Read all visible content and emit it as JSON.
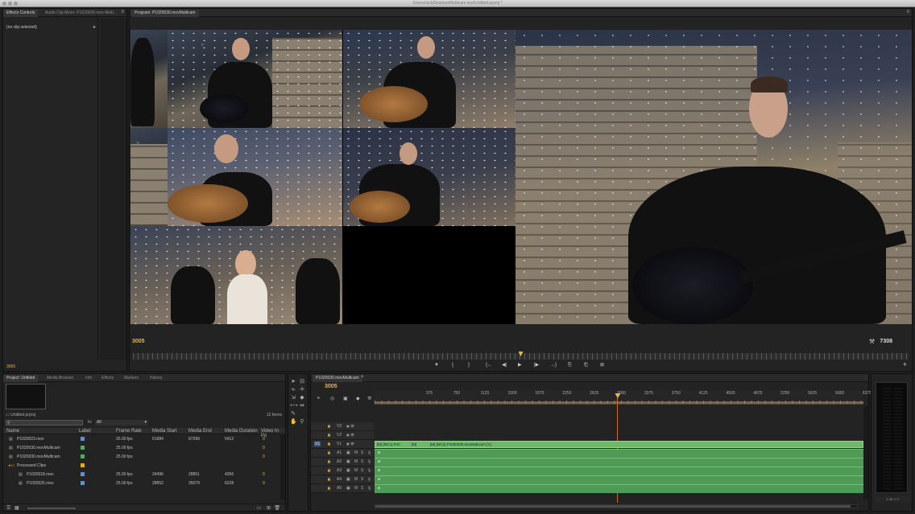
{
  "window": {
    "title": "/Users/nick/Desktop/Multicam test/Untitled.prproj *"
  },
  "effects_panel": {
    "tabs": [
      "Effects Controls",
      "Audio Clip Mixer: P1020030.mov Multi..."
    ],
    "no_clip": "(no clip selected)",
    "timecode": "3005"
  },
  "program": {
    "tab": "Program: P1020030.movMulticam",
    "timecode_current": "3005",
    "timecode_duration": "7308",
    "playhead_fraction": 0.5
  },
  "transport": {
    "buttons": [
      "▼",
      "{",
      "}",
      "{←",
      "◀|",
      "▶",
      "|▶",
      "→}",
      "⎘",
      "⎗",
      "⊞"
    ],
    "add": "+"
  },
  "project_panel": {
    "tabs": [
      "Project: Untitled",
      "Media Browser",
      "Info",
      "Effects",
      "Markers",
      "History"
    ],
    "file": "Untitled.prproj",
    "items_count": "12 Items",
    "in_label": "In:",
    "in_value": "All",
    "columns": [
      "Name",
      "Label",
      "Frame Rate",
      "Media Start",
      "Media End",
      "Media Duration",
      "Video In Po"
    ],
    "rows": [
      {
        "name": "P1020023.mov",
        "color": "#5b8fd6",
        "rate": "25.00 fps",
        "start": "61984",
        "end": "67399",
        "duration": "5412",
        "vin": "0",
        "indent": 0
      },
      {
        "name": "P1020030.movMulticam",
        "color": "#4fae5a",
        "rate": "25.00 fps",
        "start": "",
        "end": "",
        "duration": "",
        "vin": "0",
        "indent": 0
      },
      {
        "name": "P1020030.movMulticam",
        "color": "#4fae5a",
        "rate": "25.00 fps",
        "start": "",
        "end": "",
        "duration": "",
        "vin": "0",
        "indent": 0
      },
      {
        "name": "Processed Clips",
        "color": "#e0a73c",
        "rate": "",
        "start": "",
        "end": "",
        "duration": "",
        "vin": "",
        "indent": 0
      },
      {
        "name": "P1020018.mov",
        "color": "#5b8fd6",
        "rate": "25.00 fps",
        "start": "24496",
        "end": "28851",
        "duration": "4356",
        "vin": "0",
        "indent": 1
      },
      {
        "name": "P1020025.mov",
        "color": "#5b8fd6",
        "rate": "25.00 fps",
        "start": "28852",
        "end": "35079",
        "duration": "6228",
        "vin": "0",
        "indent": 1
      }
    ]
  },
  "timeline": {
    "tab": "P1020030.movMulticam",
    "timecode": "3005",
    "ruler": [
      "375",
      "750",
      "1125",
      "1500",
      "1875",
      "2250",
      "2625",
      "3000",
      "3375",
      "3750",
      "4125",
      "4500",
      "4875",
      "5250",
      "5625",
      "6000",
      "6375"
    ],
    "video_tracks": [
      "V3",
      "V2",
      "V1"
    ],
    "audio_tracks": [
      "A1",
      "A2",
      "A3",
      "A4",
      "A5"
    ],
    "v1_clips": [
      "[M] [MC1] P10",
      "[M]",
      "[M] [MC2] P1020030.movMulticam [V]"
    ],
    "mute": "M",
    "solo": "S",
    "src": "V1"
  },
  "meter": {
    "label": "0 dB  S  S"
  }
}
